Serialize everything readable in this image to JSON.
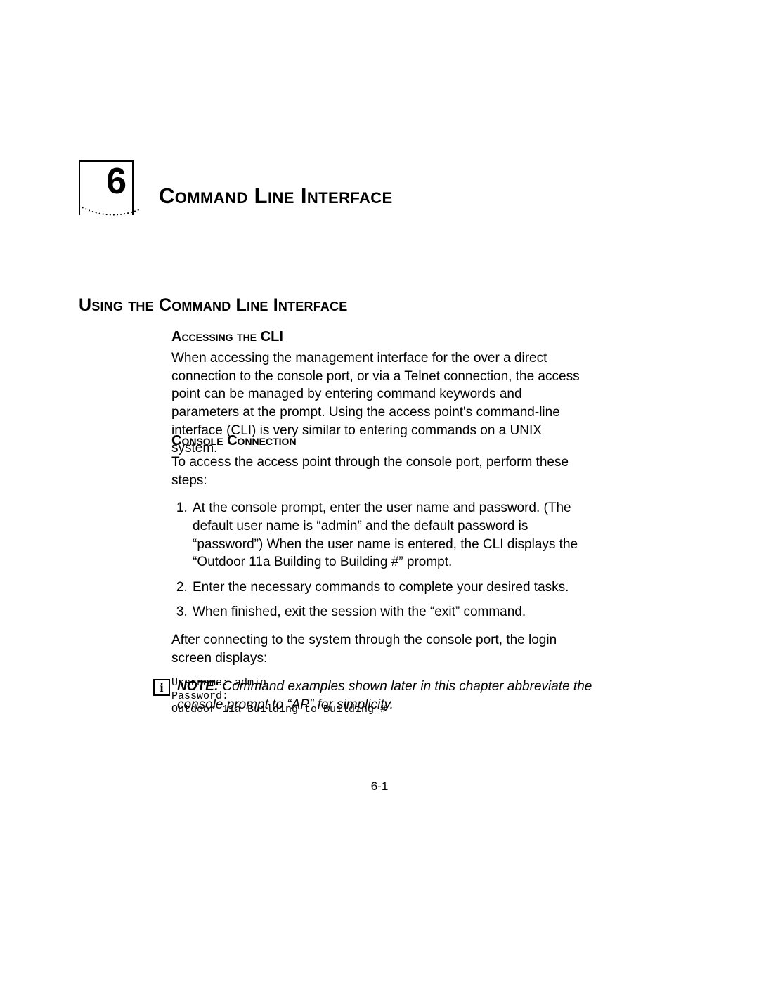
{
  "chapter": {
    "number": "6",
    "title": "Command Line Interface"
  },
  "section": {
    "title": "Using the Command Line Interface"
  },
  "accessing": {
    "title": "Accessing the CLI",
    "para": "When accessing the management interface for the over a direct connection to the console port, or via a Telnet connection, the access point can be managed by entering command keywords and parameters at the prompt. Using the access point's command-line interface (CLI) is very similar to entering commands on a UNIX system."
  },
  "console": {
    "title": "Console Connection",
    "intro": "To access the access point through the console port, perform these steps:",
    "steps": [
      "At the console prompt, enter the user name and password. (The default user name is “admin” and the default password is “password”) When the user name is entered, the CLI displays the “Outdoor 11a Building to Building #” prompt.",
      "Enter the necessary commands to complete your desired tasks.",
      "When finished, exit the session with the “exit” command."
    ],
    "after": "After connecting to the system through the console port, the login screen displays:",
    "code": "Username: admin\nPassword:\nOutdoor 11a Building to Building #"
  },
  "note": {
    "icon": "i",
    "label": "NOTE:",
    "text": "Command examples shown later in this chapter abbreviate the console prompt to “AP” for simplicity."
  },
  "pageNumber": "6-1"
}
